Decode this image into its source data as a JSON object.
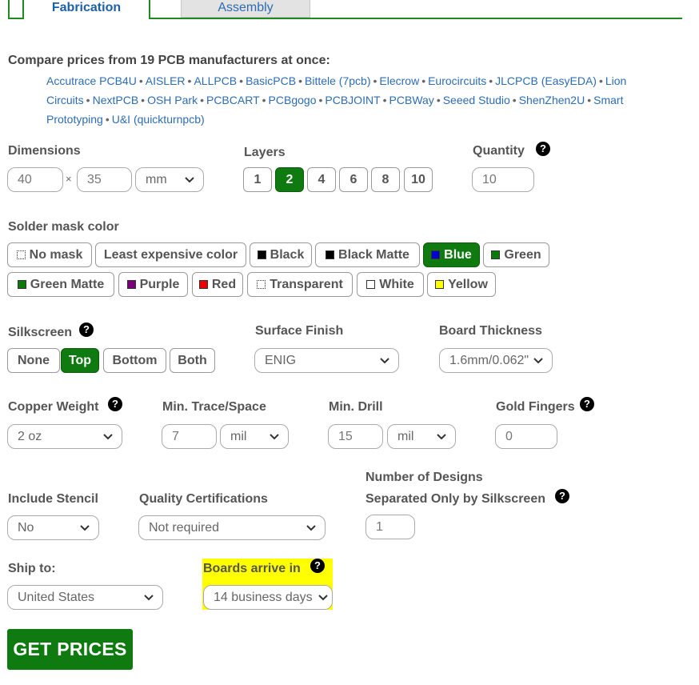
{
  "tabs": [
    {
      "label": "Fabrication"
    },
    {
      "label": "Assembly"
    }
  ],
  "compare": {
    "title": "Compare prices from 19 PCB manufacturers at once:",
    "line1": [
      "Accutrace PCB4U",
      "AISLER",
      "ALLPCB",
      "BasicPCB",
      "Bittele (7pcb)",
      "Elecrow",
      "Eurocircuits",
      "JLCPCB (EasyEDA)",
      "Lion"
    ],
    "line2": [
      "Circuits",
      "NextPCB",
      "OSH Park",
      "PCBCART",
      "PCBgogo",
      "PCBJOINT",
      "PCBWay",
      "Seeed Studio",
      "ShenZhen2U",
      "Smart"
    ],
    "line3": [
      "Prototyping",
      "U&I (quickturnpcb)"
    ],
    "separator": "•"
  },
  "dimensions": {
    "label": "Dimensions",
    "width": "40",
    "times": "×",
    "height": "35",
    "unit": "mm"
  },
  "layers": {
    "label": "Layers",
    "options": [
      "1",
      "2",
      "4",
      "6",
      "8",
      "10"
    ],
    "selected": "2"
  },
  "quantity": {
    "label": "Quantity",
    "value": "10"
  },
  "solder_mask": {
    "label": "Solder mask color",
    "options": [
      {
        "label": "No mask",
        "color": "none"
      },
      {
        "label": "Least expensive color",
        "color": ""
      },
      {
        "label": "Black",
        "color": "#000000"
      },
      {
        "label": "Black Matte",
        "color": "#000000"
      },
      {
        "label": "Blue",
        "color": "#0000cc"
      },
      {
        "label": "Green",
        "color": "#0a7a0a"
      },
      {
        "label": "Green Matte",
        "color": "#0a7a0a"
      },
      {
        "label": "Purple",
        "color": "#7a007a"
      },
      {
        "label": "Red",
        "color": "#ee0000"
      },
      {
        "label": "Transparent",
        "color": "none"
      },
      {
        "label": "White",
        "color": "#ffffff"
      },
      {
        "label": "Yellow",
        "color": "#ffff00"
      }
    ],
    "selected": "Blue"
  },
  "silkscreen": {
    "label": "Silkscreen",
    "options": [
      "None",
      "Top",
      "Bottom",
      "Both"
    ],
    "selected": "Top"
  },
  "surface_finish": {
    "label": "Surface Finish",
    "value": "ENIG"
  },
  "board_thickness": {
    "label": "Board Thickness",
    "value": "1.6mm/0.062\""
  },
  "copper_weight": {
    "label": "Copper Weight",
    "value": "2 oz"
  },
  "min_trace": {
    "label": "Min. Trace/Space",
    "value": "7",
    "unit": "mil"
  },
  "min_drill": {
    "label": "Min. Drill",
    "value": "15",
    "unit": "mil"
  },
  "gold_fingers": {
    "label": "Gold Fingers",
    "value": "0"
  },
  "stencil": {
    "label": "Include Stencil",
    "value": "No"
  },
  "certifications": {
    "label": "Quality Certifications",
    "value": "Not required"
  },
  "designs": {
    "label_line1": "Number of Designs",
    "label_line2": "Separated Only by Silkscreen",
    "value": "1"
  },
  "ship_to": {
    "label": "Ship to:",
    "value": "United States"
  },
  "arrive": {
    "label": "Boards arrive in",
    "value": "14 business days"
  },
  "help_glyph": "?",
  "get_prices": {
    "label": "GET PRICES"
  },
  "colors": {
    "accent": "#0f7a0f",
    "link": "#2d6cb3",
    "highlight": "#ffff00"
  }
}
